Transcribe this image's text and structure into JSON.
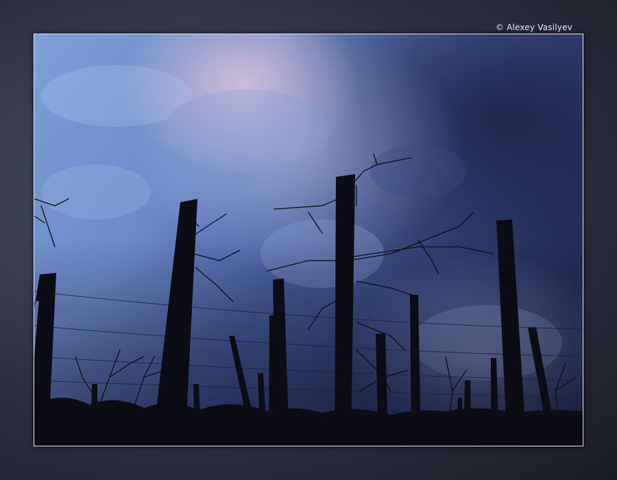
{
  "credit": {
    "text": "© Alexey Vasilyev",
    "color": "#eef0f6"
  },
  "photo": {
    "subject": "silhouette-of-cut-tree-trunks-and-wires-against-cloudy-sky",
    "colors": {
      "sky_light": "#7f9fda",
      "sky_mid": "#4d64a8",
      "sky_dark": "#25305a",
      "cloud_pink": "#d9b9c6",
      "silhouette": "#0c0d14"
    }
  },
  "frame": {
    "border_color": "#e8e8ee",
    "background": "#2c303e"
  }
}
